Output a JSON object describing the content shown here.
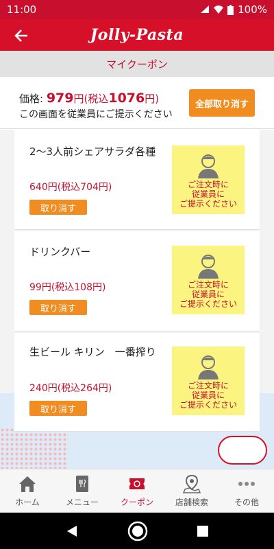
{
  "status": {
    "time": "11:00",
    "battery": "100%"
  },
  "header": {
    "logo": "Jolly-Pasta"
  },
  "subtitle": "マイクーポン",
  "price_bar": {
    "label": "価格: ",
    "price": "979",
    "price_suffix": "円(税込",
    "tax_price": "1076",
    "tax_suffix": "円)",
    "note": "この画面を従業員にご提示ください",
    "cancel_all": "全部取り消す"
  },
  "coupons": [
    {
      "name": "2〜3人前シェアサラダ各種",
      "price": "640円(税込704円)",
      "cancel": "取り消す",
      "staff_note": "ご注文時に\n従業員に\nご提示ください"
    },
    {
      "name": "ドリンクバー",
      "price": "99円(税込108円)",
      "cancel": "取り消す",
      "staff_note": "ご注文時に\n従業員に\nご提示ください"
    },
    {
      "name": "生ビール キリン　一番搾り",
      "price": "240円(税込264円)",
      "cancel": "取り消す",
      "staff_note": "ご注文時に\n従業員に\nご提示ください"
    }
  ],
  "tabs": [
    {
      "label": "ホーム",
      "icon": "home-icon"
    },
    {
      "label": "メニュー",
      "icon": "menu-book-icon"
    },
    {
      "label": "クーポン",
      "icon": "coupon-icon",
      "active": true
    },
    {
      "label": "店舗検索",
      "icon": "map-pin-icon"
    },
    {
      "label": "その他",
      "icon": "more-icon"
    }
  ],
  "colors": {
    "brand_red": "#d7102a",
    "accent_orange": "#f08c20",
    "staff_yellow": "#fbf480"
  }
}
